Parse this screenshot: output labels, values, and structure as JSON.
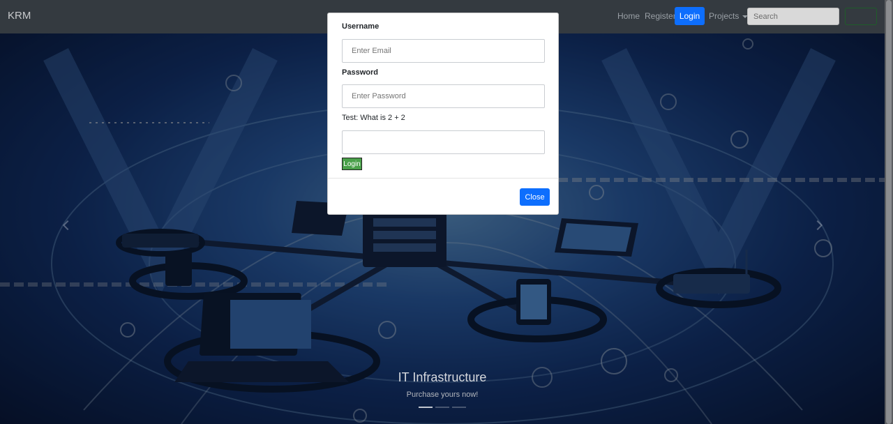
{
  "navbar": {
    "brand": "KRM",
    "links": {
      "home": "Home",
      "register": "Register",
      "login": "Login",
      "projects": "Projects"
    },
    "search": {
      "placeholder": "Search"
    }
  },
  "hero": {
    "title": "IT Infrastructure",
    "subtitle": "Purchase yours now!",
    "indicators": 3,
    "active_indicator": 1
  },
  "modal": {
    "username_label": "Username",
    "email_placeholder": "Enter Email",
    "password_label": "Password",
    "password_placeholder": "Enter Password",
    "test_question": "Test: What is 2 + 2",
    "answer_value": "",
    "login_button": "Login",
    "close_button": "Close"
  },
  "colors": {
    "navbar_bg": "#343a40",
    "primary": "#0d6efd",
    "success": "#4aa04a"
  }
}
